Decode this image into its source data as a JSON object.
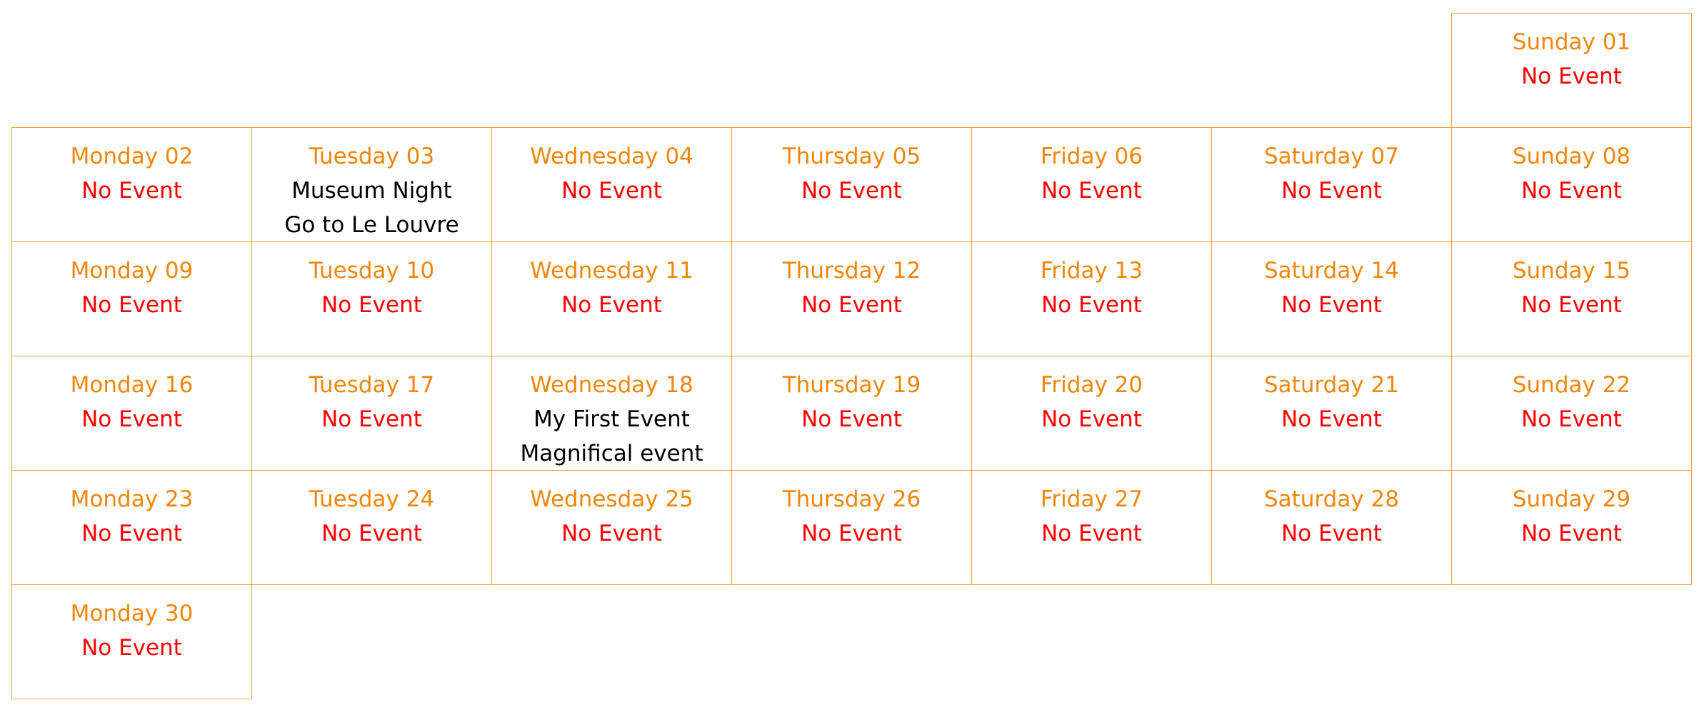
{
  "colors": {
    "border": "#f5a13a",
    "day_title": "#f0860a",
    "no_event": "#ff0000",
    "event_text": "#000000"
  },
  "calendar": {
    "days": [
      {
        "title": "Sunday 01",
        "weekday": "Sunday",
        "day": 1,
        "events": [
          "No Event"
        ]
      },
      {
        "title": "Monday 02",
        "weekday": "Monday",
        "day": 2,
        "events": [
          "No Event"
        ]
      },
      {
        "title": "Tuesday 03",
        "weekday": "Tuesday",
        "day": 3,
        "events": [
          "Museum Night",
          "Go to Le Louvre"
        ]
      },
      {
        "title": "Wednesday 04",
        "weekday": "Wednesday",
        "day": 4,
        "events": [
          "No Event"
        ]
      },
      {
        "title": "Thursday 05",
        "weekday": "Thursday",
        "day": 5,
        "events": [
          "No Event"
        ]
      },
      {
        "title": "Friday 06",
        "weekday": "Friday",
        "day": 6,
        "events": [
          "No Event"
        ]
      },
      {
        "title": "Saturday 07",
        "weekday": "Saturday",
        "day": 7,
        "events": [
          "No Event"
        ]
      },
      {
        "title": "Sunday 08",
        "weekday": "Sunday",
        "day": 8,
        "events": [
          "No Event"
        ]
      },
      {
        "title": "Monday 09",
        "weekday": "Monday",
        "day": 9,
        "events": [
          "No Event"
        ]
      },
      {
        "title": "Tuesday 10",
        "weekday": "Tuesday",
        "day": 10,
        "events": [
          "No Event"
        ]
      },
      {
        "title": "Wednesday 11",
        "weekday": "Wednesday",
        "day": 11,
        "events": [
          "No Event"
        ]
      },
      {
        "title": "Thursday 12",
        "weekday": "Thursday",
        "day": 12,
        "events": [
          "No Event"
        ]
      },
      {
        "title": "Friday 13",
        "weekday": "Friday",
        "day": 13,
        "events": [
          "No Event"
        ]
      },
      {
        "title": "Saturday 14",
        "weekday": "Saturday",
        "day": 14,
        "events": [
          "No Event"
        ]
      },
      {
        "title": "Sunday 15",
        "weekday": "Sunday",
        "day": 15,
        "events": [
          "No Event"
        ]
      },
      {
        "title": "Monday 16",
        "weekday": "Monday",
        "day": 16,
        "events": [
          "No Event"
        ]
      },
      {
        "title": "Tuesday 17",
        "weekday": "Tuesday",
        "day": 17,
        "events": [
          "No Event"
        ]
      },
      {
        "title": "Wednesday 18",
        "weekday": "Wednesday",
        "day": 18,
        "events": [
          "My First Event",
          "Magnifical event"
        ]
      },
      {
        "title": "Thursday 19",
        "weekday": "Thursday",
        "day": 19,
        "events": [
          "No Event"
        ]
      },
      {
        "title": "Friday 20",
        "weekday": "Friday",
        "day": 20,
        "events": [
          "No Event"
        ]
      },
      {
        "title": "Saturday 21",
        "weekday": "Saturday",
        "day": 21,
        "events": [
          "No Event"
        ]
      },
      {
        "title": "Sunday 22",
        "weekday": "Sunday",
        "day": 22,
        "events": [
          "No Event"
        ]
      },
      {
        "title": "Monday 23",
        "weekday": "Monday",
        "day": 23,
        "events": [
          "No Event"
        ]
      },
      {
        "title": "Tuesday 24",
        "weekday": "Tuesday",
        "day": 24,
        "events": [
          "No Event"
        ]
      },
      {
        "title": "Wednesday 25",
        "weekday": "Wednesday",
        "day": 25,
        "events": [
          "No Event"
        ]
      },
      {
        "title": "Thursday 26",
        "weekday": "Thursday",
        "day": 26,
        "events": [
          "No Event"
        ]
      },
      {
        "title": "Friday 27",
        "weekday": "Friday",
        "day": 27,
        "events": [
          "No Event"
        ]
      },
      {
        "title": "Saturday 28",
        "weekday": "Saturday",
        "day": 28,
        "events": [
          "No Event"
        ]
      },
      {
        "title": "Sunday 29",
        "weekday": "Sunday",
        "day": 29,
        "events": [
          "No Event"
        ]
      },
      {
        "title": "Monday 30",
        "weekday": "Monday",
        "day": 30,
        "events": [
          "No Event"
        ]
      }
    ]
  }
}
